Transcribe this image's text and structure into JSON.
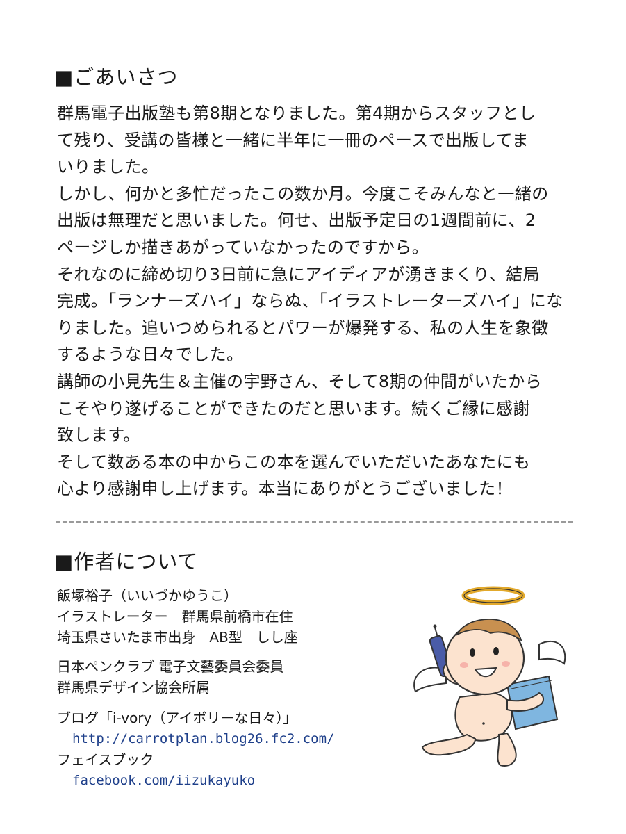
{
  "greeting": {
    "heading": "■ごあいさつ",
    "lines": [
      "群馬電子出版塾も第8期となりました。第4期からスタッフとし",
      "て残り、受講の皆様と一緒に半年に一冊のペースで出版してま",
      "いりました。",
      "しかし、何かと多忙だったこの数か月。今度こそみんなと一緒の",
      "出版は無理だと思いました。何せ、出版予定日の1週間前に、2",
      "ページしか描きあがっていなかったのですから。",
      "それなのに締め切り3日前に急にアイディアが湧きまくり、結局",
      "完成。「ランナーズハイ」ならぬ、「イラストレーターズハイ」にな",
      "りました。追いつめられるとパワーが爆発する、私の人生を象徴",
      "するような日々でした。",
      "講師の小見先生＆主催の宇野さん、そして8期の仲間がいたから",
      "こそやり遂げることができたのだと思います。続くご縁に感謝",
      "致します。",
      "そして数ある本の中からこの本を選んでいただいたあなたにも",
      "心より感謝申し上げます。本当にありがとうございました！"
    ]
  },
  "author": {
    "heading": "■作者について",
    "profile": [
      "飯塚裕子（いいづかゆうこ）",
      "イラストレーター　群馬県前橋市在住",
      "埼玉県さいたま市出身　AB型　しし座"
    ],
    "affiliations": [
      "日本ペンクラブ 電子文藝委員会委員",
      "群馬県デザイン協会所属"
    ],
    "blog_label": "ブログ「i-vory（アイボリーな日々）」",
    "blog_url": "http://carrotplan.blog26.fc2.com/",
    "facebook_label": "フェイスブック",
    "facebook_url": "facebook.com/iizukayuko"
  },
  "colors": {
    "text": "#1a1a1a",
    "link": "#1e3f8a",
    "halo": "#e2a92c",
    "book": "#7fb6e0",
    "phone": "#4a5ca8",
    "skin": "#fce3cf"
  },
  "icons": {
    "illustration": "angel-baby-icon"
  }
}
